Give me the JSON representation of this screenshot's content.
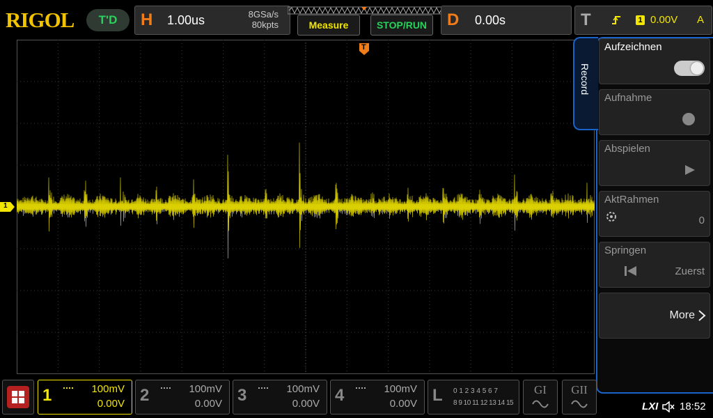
{
  "header": {
    "logo": "RIGOL",
    "mode": "T'D",
    "horizontal": {
      "letter": "H",
      "timebase": "1.00us",
      "sample_rate": "8GSa/s",
      "memory": "80kpts"
    },
    "measure_label": "Measure",
    "stoprun_label": "STOP/RUN",
    "delay": {
      "letter": "D",
      "value": "0.00s"
    },
    "trigger": {
      "letter": "T",
      "source": "1",
      "level": "0.00V",
      "mode": "A"
    }
  },
  "channel_marker": "1",
  "trigger_marker": "T",
  "menu": {
    "tab_label": "Record",
    "items": [
      {
        "label": "Aufzeichnen",
        "control": "toggle"
      },
      {
        "label": "Aufnahme",
        "control": "dot"
      },
      {
        "label": "Abspielen",
        "control": "play"
      },
      {
        "label": "AktRahmen",
        "value": "0"
      },
      {
        "label": "Springen",
        "value": "Zuerst"
      },
      {
        "label": "More"
      }
    ]
  },
  "channels": [
    {
      "num": "1",
      "scale": "100mV",
      "offset": "0.00V",
      "active": true
    },
    {
      "num": "2",
      "scale": "100mV",
      "offset": "0.00V",
      "active": false
    },
    {
      "num": "3",
      "scale": "100mV",
      "offset": "0.00V",
      "active": false
    },
    {
      "num": "4",
      "scale": "100mV",
      "offset": "0.00V",
      "active": false
    }
  ],
  "logic": {
    "letter": "L",
    "row1": "0 1 2 3  4 5 6 7",
    "row2": "8 9 10 11 12 13 14 15"
  },
  "generators": [
    "GI",
    "GII"
  ],
  "status": {
    "lxi": "LXI",
    "time": "18:52"
  },
  "colors": {
    "ch1": "#f2e600",
    "accent": "#1a63c9",
    "orange": "#f07d1a",
    "green": "#27d35a"
  }
}
